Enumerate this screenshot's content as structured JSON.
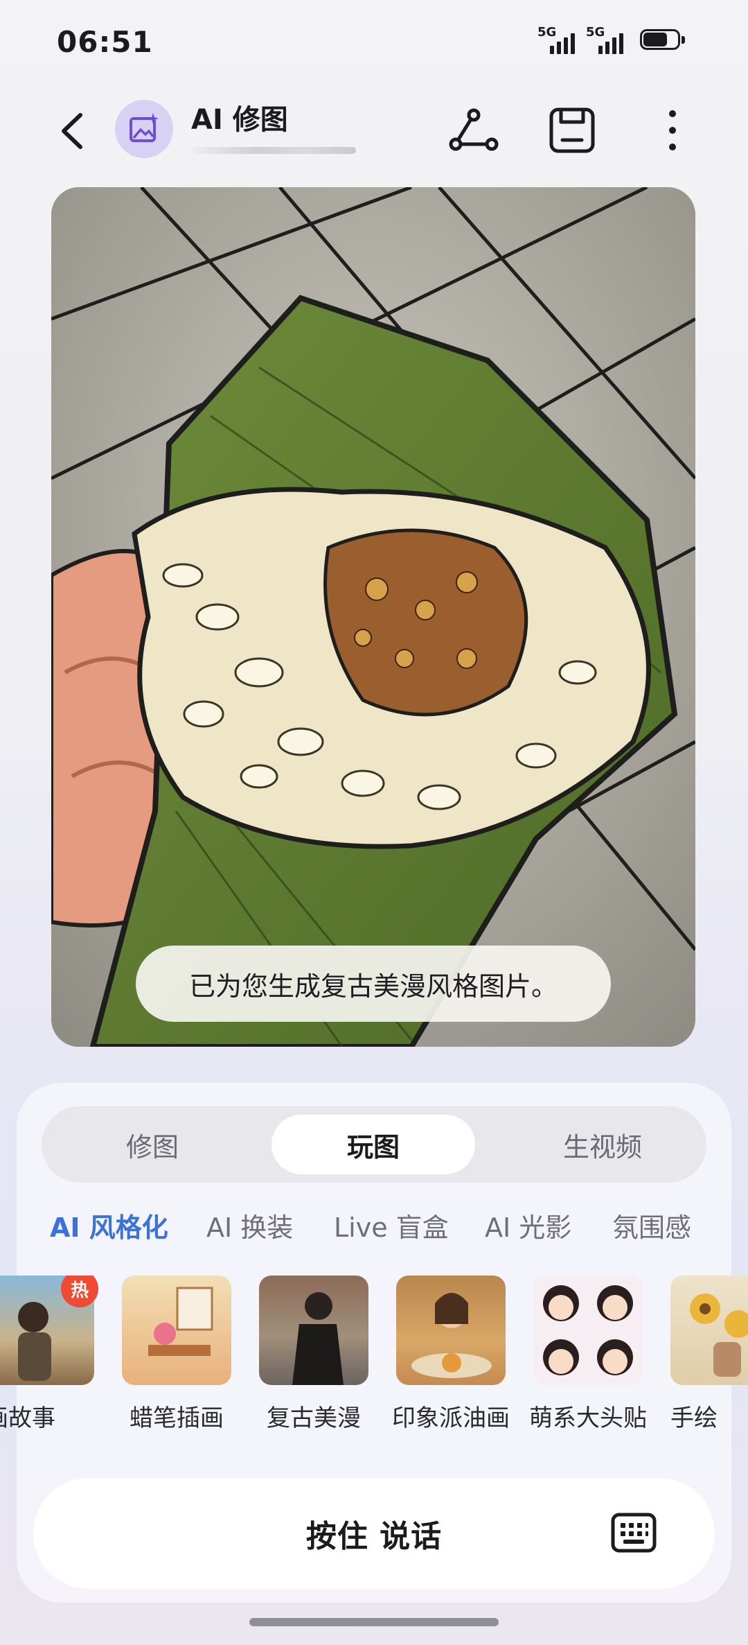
{
  "status_bar": {
    "time": "06:51",
    "sim1": "5G",
    "sim2": "5G",
    "battery_level": 0.7
  },
  "header": {
    "title": "AI 修图",
    "back_icon": "chevron-left-icon",
    "avatar_icon": "image-sparkle-icon",
    "share_icon": "share-icon",
    "save_icon": "save-icon",
    "more_icon": "more-vertical-icon",
    "accent": "#d8d1f3"
  },
  "result": {
    "toast": "已为您生成复古美漫风格图片。"
  },
  "mode_tabs": [
    {
      "label": "修图",
      "active": false
    },
    {
      "label": "玩图",
      "active": true
    },
    {
      "label": "生视频",
      "active": false
    }
  ],
  "style_tabs": [
    {
      "label": "AI 风格化",
      "active": true
    },
    {
      "label": "AI 换装",
      "active": false
    },
    {
      "label": "Live 盲盒",
      "active": false
    },
    {
      "label": "AI 光影",
      "active": false
    },
    {
      "label": "氛围感",
      "active": false
    }
  ],
  "styles": [
    {
      "label": "画故事",
      "badge": "热"
    },
    {
      "label": "蜡笔插画"
    },
    {
      "label": "复古美漫"
    },
    {
      "label": "印象派油画"
    },
    {
      "label": "萌系大头贴"
    },
    {
      "label": "手绘"
    }
  ],
  "voice": {
    "label": "按住 说话",
    "keyboard_icon": "keyboard-icon"
  },
  "colors": {
    "active_tab": "#3a72d9",
    "hot_badge": "#ee4a34"
  }
}
